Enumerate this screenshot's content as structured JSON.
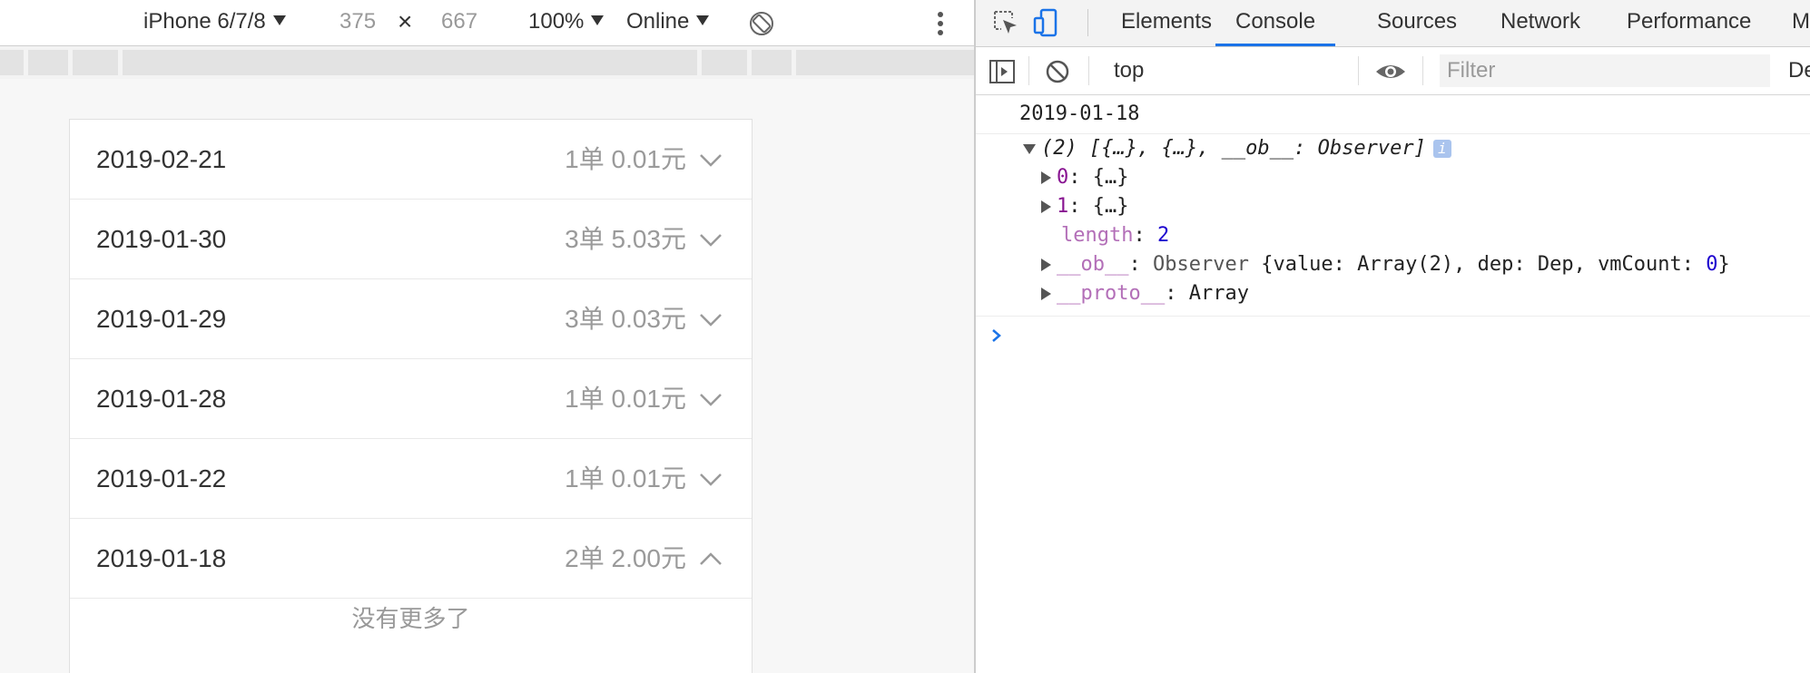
{
  "device_toolbar": {
    "device_name": "iPhone 6/7/8",
    "width": "375",
    "times": "×",
    "height": "667",
    "zoom": "100%",
    "throttle": "Online"
  },
  "phone_page": {
    "rows": [
      {
        "date": "2019-02-21",
        "summary": "1单 0.01元",
        "expanded": false
      },
      {
        "date": "2019-01-30",
        "summary": "3单 5.03元",
        "expanded": false
      },
      {
        "date": "2019-01-29",
        "summary": "3单 0.03元",
        "expanded": false
      },
      {
        "date": "2019-01-28",
        "summary": "1单 0.01元",
        "expanded": false
      },
      {
        "date": "2019-01-22",
        "summary": "1单 0.01元",
        "expanded": false
      },
      {
        "date": "2019-01-18",
        "summary": "2单 2.00元",
        "expanded": true
      }
    ],
    "no_more": "没有更多了"
  },
  "devtools": {
    "tabs": {
      "elements": "Elements",
      "console": "Console",
      "sources": "Sources",
      "network": "Network",
      "performance": "Performance",
      "more": "M"
    },
    "console_toolbar": {
      "context": "top",
      "filter_placeholder": "Filter",
      "levels": "Def"
    },
    "log": {
      "date_line": "2019-01-18",
      "array_summary": "(2) [{…}, {…}, __ob__: Observer]",
      "info_badge": "i",
      "items": [
        {
          "key": "0",
          "value": "{…}"
        },
        {
          "key": "1",
          "value": "{…}"
        }
      ],
      "length_key": "length",
      "length_value": "2",
      "ob_key": "__ob__",
      "ob_type": "Observer",
      "ob_body_a": "{value: Array(2), dep: Dep, vmCount: ",
      "ob_vmcount": "0",
      "ob_body_b": "}",
      "proto_key": "__proto__",
      "proto_value": "Array"
    }
  },
  "colors": {
    "accent": "#1a73e8",
    "prompt": "#1a73e8",
    "key": "#881391",
    "number": "#1c00cf"
  }
}
